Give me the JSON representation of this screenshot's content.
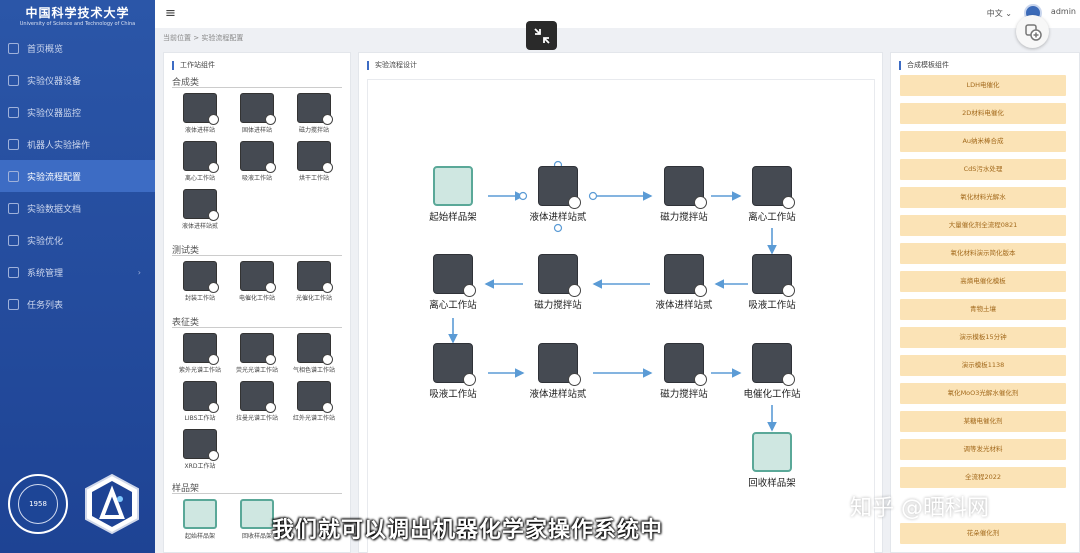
{
  "university": {
    "name_cn": "中国科学技术大学",
    "name_en": "University of Science and Technology of China"
  },
  "sidebar": {
    "items": [
      {
        "label": "首页概览",
        "active": false
      },
      {
        "label": "实验仪器设备",
        "active": false
      },
      {
        "label": "实验仪器监控",
        "active": false
      },
      {
        "label": "机器人实验操作",
        "active": false
      },
      {
        "label": "实验流程配置",
        "active": true
      },
      {
        "label": "实验数据文档",
        "active": false
      },
      {
        "label": "实验优化",
        "active": false
      },
      {
        "label": "系统管理",
        "active": false,
        "has_arrow": true
      },
      {
        "label": "任务列表",
        "active": false
      }
    ],
    "emblem_year": "1958"
  },
  "topbar": {
    "menu_icon": "hamburger-icon",
    "lang": "中文",
    "user": "admin"
  },
  "breadcrumb": "当前位置 > 实验流程配置",
  "left_panel": {
    "title": "工作站组件",
    "cat_synthesis": "合成类",
    "cat_test": "测试类",
    "cat_character": "表征类",
    "cat_rack": "样品架",
    "comp_liquid": "液体进样站",
    "comp_solid": "固体进样站",
    "comp_stir": "磁力搅拌站",
    "comp_centrifuge": "离心工作站",
    "comp_pipette": "吸液工作站",
    "comp_dry": "烘干工作站",
    "comp_liquid2": "液体进样站贰",
    "comp_seal": "封装工作站",
    "comp_electro": "电催化工作站",
    "comp_photo": "光催化工作站",
    "comp_uv": "紫外光谱工作站",
    "comp_fluor": "荧光光谱工作站",
    "comp_gc": "气相色谱工作站",
    "comp_libs": "LIBS工作站",
    "comp_raman": "拉曼光谱工作站",
    "comp_ir": "红外光谱工作站",
    "comp_xrd": "XRD工作站",
    "comp_start_rack": "起始样品架",
    "comp_recover_rack": "回收样品架"
  },
  "center_panel": {
    "title": "实验流程设计",
    "n_start": "起始样品架",
    "n_liquid_a": "液体进样站贰",
    "n_stir_a": "磁力搅拌站",
    "n_centri_a": "离心工作站",
    "n_centri_b": "离心工作站",
    "n_stir_b": "磁力搅拌站",
    "n_liquid_b": "液体进样站贰",
    "n_pipette_a": "吸液工作站",
    "n_pipette_b": "吸液工作站",
    "n_liquid_c": "液体进样站贰",
    "n_stir_c": "磁力搅拌站",
    "n_electro": "电催化工作站",
    "n_recover": "回收样品架"
  },
  "right_panel": {
    "title": "合成模板组件",
    "templates": [
      "LDH电催化",
      "2D材料电催化",
      "Au纳米棒合成",
      "CdS污水处理",
      "氧化材料光解水",
      "大量催化剂全流程0821",
      "氧化材料演示简化版本",
      "高熵电催化模板",
      "青物土壤",
      "演示模板15分钟",
      "演示模板1138",
      "氧化MoO3光解水催化剂",
      "某糖电催化剂",
      "调等发光材料",
      "全流程2022",
      "花朵催化剂"
    ]
  },
  "subtitle": "我们就可以调出机器化学家操作系统中",
  "watermark": "知乎 @晒科网",
  "colors": {
    "sidebar": "#2b56a8",
    "active": "#3d6cc4",
    "template_bg": "#fbe3b6",
    "template_text": "#a36a1d",
    "arrow": "#5b9bd5"
  }
}
